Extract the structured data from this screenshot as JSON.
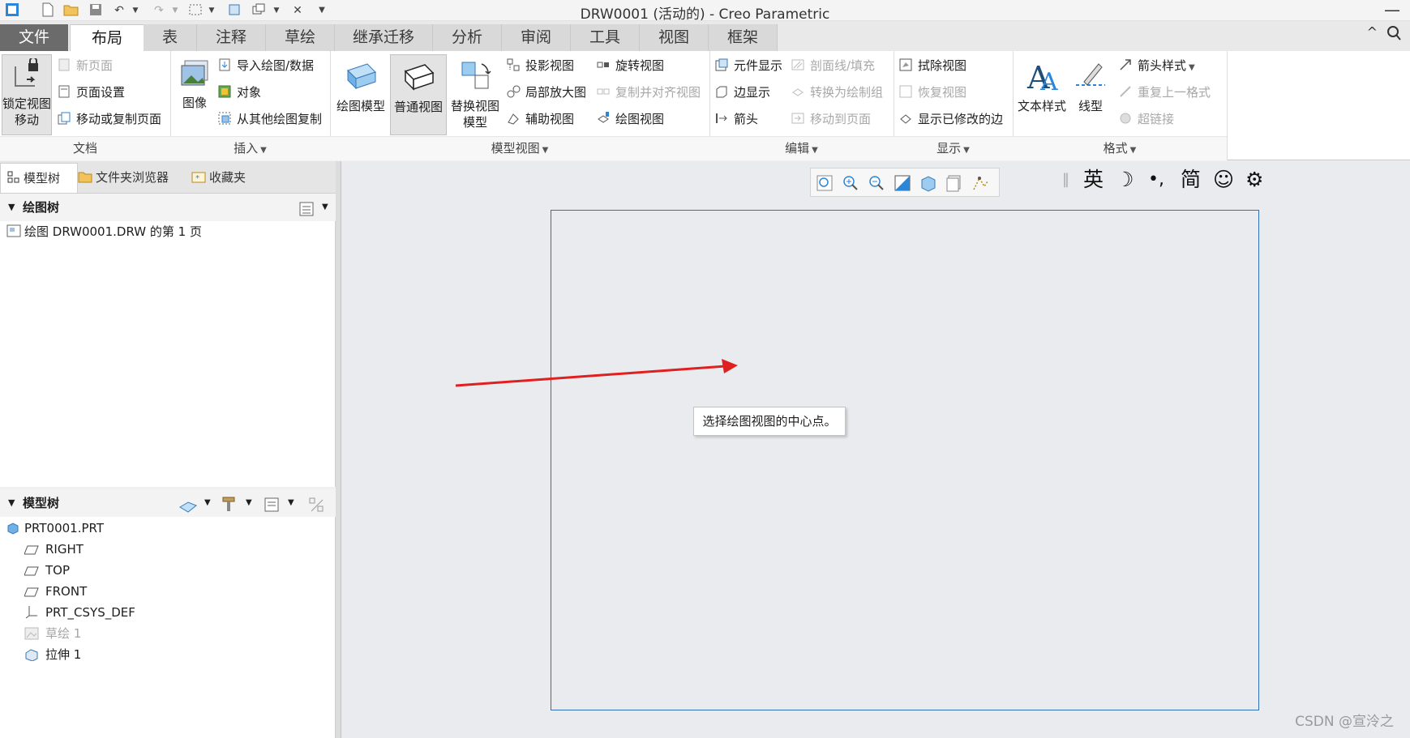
{
  "window": {
    "title": "DRW0001 (活动的) - Creo Parametric",
    "minimize_glyph": "—"
  },
  "tabs": [
    "文件",
    "布局",
    "表",
    "注释",
    "草绘",
    "继承迁移",
    "分析",
    "审阅",
    "工具",
    "视图",
    "框架"
  ],
  "ribbon": {
    "document": {
      "group_label": "文档",
      "lock_view": "锁定视图",
      "lock_view_2": "移动",
      "new_page": "新页面",
      "page_setup": "页面设置",
      "move_copy_page": "移动或复制页面"
    },
    "insert": {
      "group_label": "插入",
      "image": "图像",
      "import_drawing": "导入绘图/数据",
      "object": "对象",
      "copy_from_drawing": "从其他绘图复制"
    },
    "model_views": {
      "group_label": "模型视图",
      "drawing_models": "绘图模型",
      "general_view": "普通视图",
      "replace_model": "替换视图",
      "replace_model_2": "模型",
      "projection_view": "投影视图",
      "detailed_view": "局部放大图",
      "auxiliary_view": "辅助视图",
      "revolved_view": "旋转视图",
      "copy_align_view": "复制并对齐视图",
      "drawing_view": "绘图视图"
    },
    "edit": {
      "group_label": "编辑",
      "component_display": "元件显示",
      "edge_display": "边显示",
      "arrows": "箭头",
      "hatching": "剖面线/填充",
      "convert_to_draft": "转换为绘制组",
      "move_to_page": "移动到页面"
    },
    "display": {
      "group_label": "显示",
      "erase_view": "拭除视图",
      "resume_view": "恢复视图",
      "show_modified_edges": "显示已修改的边"
    },
    "format": {
      "group_label": "格式",
      "text_style": "文本样式",
      "line_style": "线型",
      "arrow_style": "箭头样式",
      "repeat_last_format": "重复上一格式",
      "hyperlink": "超链接"
    }
  },
  "left_panel": {
    "tabs": [
      "模型树",
      "文件夹浏览器",
      "收藏夹"
    ],
    "drawing_tree": {
      "header": "绘图树",
      "items": [
        "绘图 DRW0001.DRW 的第 1 页"
      ]
    },
    "model_tree": {
      "header": "模型树",
      "root": "PRT0001.PRT",
      "items": [
        "RIGHT",
        "TOP",
        "FRONT",
        "PRT_CSYS_DEF",
        "草绘 1",
        "拉伸 1"
      ]
    }
  },
  "canvas": {
    "tooltip": "选择绘图视图的中心点。",
    "watermark": "CSDN @宣泠之",
    "arrow_color": "#e02020",
    "sheet_border_color": "#2f6fb3"
  },
  "ime": {
    "lang": "英",
    "punct": "•,",
    "script": "简"
  },
  "colors": {
    "file_tab": "#6b6b6b",
    "canvas_bg": "#e9ebef",
    "accent_blue": "#2b86d8"
  }
}
